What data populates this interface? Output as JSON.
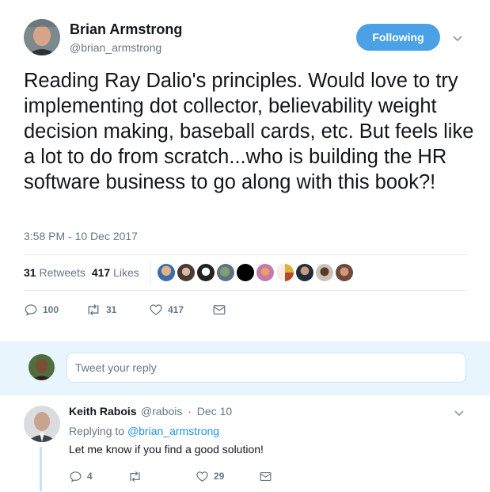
{
  "tweet": {
    "author_name": "Brian Armstrong",
    "author_handle": "@brian_armstrong",
    "follow_label": "Following",
    "text": "Reading Ray Dalio's principles. Would love to try implementing dot collector, believability weight decision making, baseball cards, etc. But feels like a lot to do from scratch...who is building the HR software business to go along with this book?!",
    "timestamp": "3:58 PM - 10 Dec 2017",
    "retweets_count": "31",
    "retweets_label": "Retweets",
    "likes_count": "417",
    "likes_label": "Likes",
    "actions": {
      "replies": "100",
      "retweets": "31",
      "likes": "417"
    }
  },
  "reply_box": {
    "placeholder": "Tweet your reply"
  },
  "reply": {
    "author_name": "Keith Rabois",
    "author_handle": "@rabois",
    "separator": "·",
    "date": "Dec 10",
    "replying_prefix": "Replying to",
    "replying_to": "@brian_armstrong",
    "text": "Let me know if you find a good solution!",
    "actions": {
      "replies": "4",
      "retweets": "",
      "likes": "29"
    }
  },
  "colors": {
    "follow_button": "#4aa1e6",
    "link": "#1b95e0",
    "muted": "#657786",
    "reply_bg": "#e8f5fd"
  },
  "icons": [
    "chevron-down-icon",
    "reply-icon",
    "retweet-icon",
    "like-icon",
    "dm-icon"
  ]
}
